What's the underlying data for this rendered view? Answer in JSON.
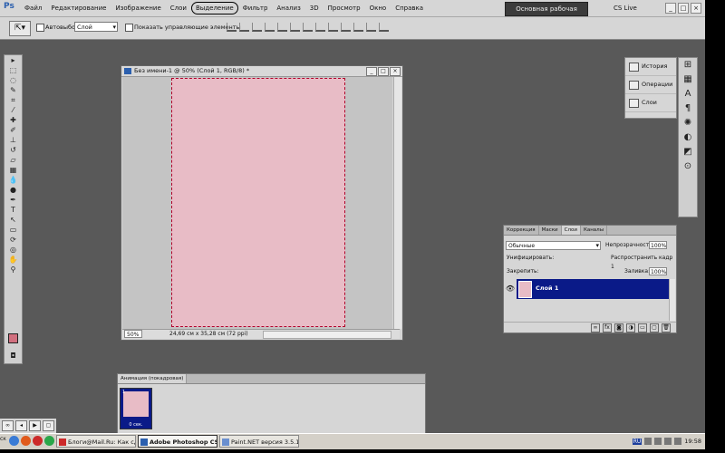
{
  "menubar": {
    "items": [
      "Файл",
      "Редактирование",
      "Изображение",
      "Слои",
      "Выделение",
      "Фильтр",
      "Анализ",
      "3D",
      "Просмотр",
      "Окно",
      "Справка"
    ],
    "selected_index": 4,
    "zoom": "50%",
    "workspace": "Основная рабочая среда",
    "cslive": "CS Live"
  },
  "options": {
    "autoselect_label": "Автовыбор:",
    "autoselect_value": "Слой",
    "show_controls_label": "Показать управляющие элементы"
  },
  "document": {
    "title": "Без имени-1 @ 50% (Слой 1, RGB/8) *",
    "zoom": "50%",
    "info": "24,69 см x 35,28 см (72 ppi)",
    "canvas_color": "#e8bcc6"
  },
  "mini_panels": {
    "history": "История",
    "actions": "Операции",
    "layers": "Слои"
  },
  "layers_panel": {
    "tabs": [
      "Коррекция",
      "Маски",
      "Слои",
      "Каналы"
    ],
    "active_tab": 2,
    "blend_mode": "Обычные",
    "opacity_label": "Непрозрачность:",
    "opacity_value": "100%",
    "unify_label": "Унифицировать:",
    "propagate_label": "Распространить кадр 1",
    "lock_label": "Закрепить:",
    "fill_label": "Заливка:",
    "fill_value": "100%",
    "layer_name": "Слой 1"
  },
  "animation": {
    "tab": "Анимация (покадровая)",
    "frame_number": "1",
    "frame_time": "0 сек."
  },
  "taskbar": {
    "start": "ск",
    "tasks": [
      "Блоги@Mail.Ru: Как сде...",
      "Adobe Photoshop CS...",
      "Paint.NET версия 3.5.10"
    ],
    "active_task": 1,
    "lang": "RU",
    "time": "19:58"
  }
}
